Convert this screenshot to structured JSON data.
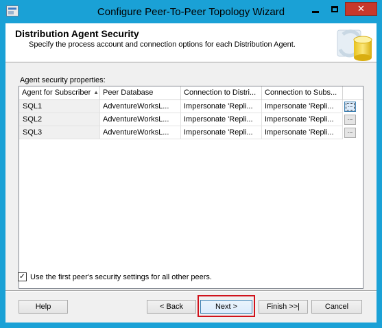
{
  "window": {
    "title": "Configure Peer-To-Peer Topology Wizard"
  },
  "header": {
    "title": "Distribution Agent Security",
    "subtitle": "Specify the process account and connection options for each Distribution Agent."
  },
  "grid": {
    "label": "Agent security properties:",
    "columns": [
      "Agent for Subscriber",
      "Peer Database",
      "Connection to Distri...",
      "Connection to Subs..."
    ],
    "rows": [
      [
        "SQL1",
        "AdventureWorksL...",
        "Impersonate 'Repli...",
        "Impersonate 'Repli..."
      ],
      [
        "SQL2",
        "AdventureWorksL...",
        "Impersonate 'Repli...",
        "Impersonate 'Repli..."
      ],
      [
        "SQL3",
        "AdventureWorksL...",
        "Impersonate 'Repli...",
        "Impersonate 'Repli..."
      ]
    ],
    "row_button_label": "...",
    "sort_glyph": "▲"
  },
  "options": {
    "use_first_peer_label": "Use the first peer's security settings for all other peers.",
    "use_first_peer_checked": true,
    "check_glyph": "✓"
  },
  "buttons": {
    "help": "Help",
    "back": "< Back",
    "next": "Next >",
    "finish": "Finish >>|",
    "cancel": "Cancel"
  },
  "titlebar_buttons": {
    "close_glyph": "✕"
  },
  "colors": {
    "title_bar": "#1aa1d6",
    "close_button": "#c7382c",
    "highlight": "#d0121b"
  }
}
